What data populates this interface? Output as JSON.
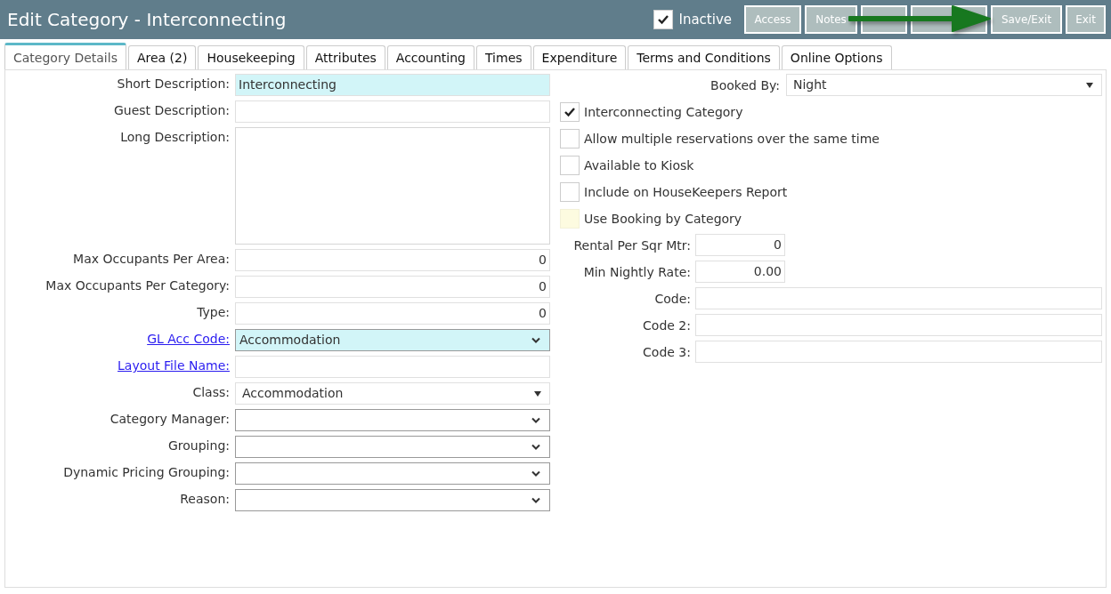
{
  "window": {
    "title": "Edit Category - Interconnecting"
  },
  "inactive": {
    "label": "Inactive",
    "checked": true
  },
  "buttons": [
    {
      "kind": "text",
      "label": "Access"
    },
    {
      "kind": "text",
      "label": "Notes"
    },
    {
      "kind": "blank"
    },
    {
      "kind": "blank"
    },
    {
      "kind": "text",
      "label": "Save/Exit"
    },
    {
      "kind": "text",
      "label": "Exit"
    }
  ],
  "tabs": [
    {
      "label": "Category Details",
      "selected": true
    },
    {
      "label": "Area (2)",
      "selected": false
    },
    {
      "label": "Housekeeping",
      "selected": false
    },
    {
      "label": "Attributes",
      "selected": false
    },
    {
      "label": "Accounting",
      "selected": false
    },
    {
      "label": "Times",
      "selected": false
    },
    {
      "label": "Expenditure",
      "selected": false
    },
    {
      "label": "Terms and Conditions",
      "selected": false
    },
    {
      "label": "Online Options",
      "selected": false
    }
  ],
  "left_fields": [
    {
      "kind": "text",
      "label": "Short Description:",
      "value": "Interconnecting",
      "highlighted": true,
      "link": false
    },
    {
      "kind": "text",
      "label": "Guest Description:",
      "highlighted": false,
      "link": false
    },
    {
      "kind": "textarea",
      "label": "Long Description:",
      "highlighted": false,
      "link": false
    },
    {
      "kind": "number",
      "label": "Max Occupants Per Area:",
      "value": "0",
      "highlighted": false,
      "link": false
    },
    {
      "kind": "number",
      "label": "Max Occupants Per Category:",
      "value": "0",
      "highlighted": false,
      "link": false
    },
    {
      "kind": "number",
      "label": "Type:",
      "value": "0",
      "highlighted": false,
      "link": false
    },
    {
      "kind": "select",
      "label": "GL Acc Code:",
      "value": "Accommodation",
      "highlighted": true,
      "link": true
    },
    {
      "kind": "text",
      "label": "Layout File Name:",
      "highlighted": false,
      "link": true
    },
    {
      "kind": "dropdown",
      "label": "Class:",
      "value": "Accommodation",
      "highlighted": false,
      "link": false
    },
    {
      "kind": "select",
      "label": "Category Manager:",
      "highlighted": false,
      "link": false
    },
    {
      "kind": "select",
      "label": "Grouping:",
      "highlighted": false,
      "link": false
    },
    {
      "kind": "select",
      "label": "Dynamic Pricing Grouping:",
      "highlighted": false,
      "link": false
    },
    {
      "kind": "select",
      "label": "Reason:",
      "highlighted": false,
      "link": false
    }
  ],
  "right_fields": [
    {
      "kind": "dropdown",
      "label": "Booked By:",
      "value": "Night"
    },
    {
      "kind": "checkbox",
      "label": "Interconnecting Category",
      "checked": true,
      "highlighted": false
    },
    {
      "kind": "checkbox",
      "label": "Allow multiple reservations over the same time",
      "checked": false,
      "highlighted": false
    },
    {
      "kind": "checkbox",
      "label": "Available to Kiosk",
      "checked": false,
      "highlighted": false
    },
    {
      "kind": "checkbox",
      "label": "Include on HouseKeepers Report",
      "checked": false,
      "highlighted": false
    },
    {
      "kind": "checkbox",
      "label": "Use Booking by Category",
      "checked": false,
      "highlighted": true
    },
    {
      "kind": "short",
      "label": "Rental Per Sqr Mtr:",
      "value": "0"
    },
    {
      "kind": "short",
      "label": "Min Nightly Rate:",
      "value": "0.00"
    },
    {
      "kind": "wide",
      "label": "Code:"
    },
    {
      "kind": "wide",
      "label": "Code 2:"
    },
    {
      "kind": "wide",
      "label": "Code 3:"
    }
  ]
}
